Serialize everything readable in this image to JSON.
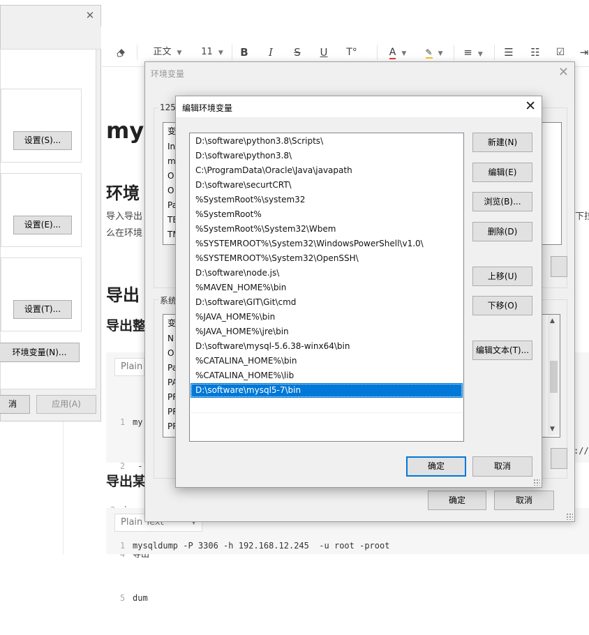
{
  "toolbar": {
    "eraser_icon": "eraser-icon",
    "style_value": "正文",
    "font_size": "11",
    "bold": "B",
    "italic": "I",
    "strike": "S",
    "underline": "U",
    "super": "T°",
    "font_color": "A",
    "highlight": "✎"
  },
  "document": {
    "heading1": "mys",
    "heading2": "环境",
    "para1_left": "导入导出",
    "para1_right": "下拉",
    "para2_left": "么在环境",
    "heading3": "导出",
    "heading4": "导出整",
    "heading5": "导出某",
    "code1_lang": "Plain",
    "code1_lines": [
      {
        "n": "1",
        "t": "my"
      },
      {
        "n": "2",
        "t": " -"
      },
      {
        "n": "3",
        "t": "ip-"
      },
      {
        "n": "4",
        "t": "导出"
      },
      {
        "n": "5",
        "t": "dum"
      }
    ],
    "code1_right": "://",
    "code2_lang": "Plain Text",
    "code2_line_no": "1",
    "code2_line": "mysqldump -P 3306 -h 192.168.12.245  -u root -proot"
  },
  "system_dialog": {
    "btn_settings_s": "设置(S)...",
    "btn_settings_e": "设置(E)...",
    "btn_settings_t": "设置(T)...",
    "btn_env": "环境变量(N)...",
    "btn_cancel": "消",
    "btn_apply": "应用(A)"
  },
  "env_dialog": {
    "title": "环境变量",
    "user_group": "125",
    "user_col": "变",
    "user_rows": [
      "In",
      "m",
      "O",
      "O",
      "Pa",
      "TE",
      "TM"
    ],
    "sys_group": "系统",
    "sys_col": "变",
    "sys_rows": [
      "N",
      "O",
      "Pa",
      "PA",
      "PR",
      "PR",
      "PR"
    ],
    "ok": "确定",
    "cancel": "取消"
  },
  "edit_dialog": {
    "title": "编辑环境变量",
    "paths": [
      "D:\\software\\python3.8\\Scripts\\",
      "D:\\software\\python3.8\\",
      "C:\\ProgramData\\Oracle\\Java\\javapath",
      "D:\\software\\securtCRT\\",
      "%SystemRoot%\\system32",
      "%SystemRoot%",
      "%SystemRoot%\\System32\\Wbem",
      "%SYSTEMROOT%\\System32\\WindowsPowerShell\\v1.0\\",
      "%SYSTEMROOT%\\System32\\OpenSSH\\",
      "D:\\software\\node.js\\",
      "%MAVEN_HOME%\\bin",
      "D:\\software\\GIT\\Git\\cmd",
      "%JAVA_HOME%\\bin",
      "%JAVA_HOME%\\jre\\bin",
      "D:\\software\\mysql-5.6.38-winx64\\bin",
      "%CATALINA_HOME%\\bin",
      "%CATALINA_HOME%\\lib",
      "D:\\software\\mysql5-7\\bin"
    ],
    "selected_index": 17,
    "btn_new": "新建(N)",
    "btn_edit": "编辑(E)",
    "btn_browse": "浏览(B)...",
    "btn_delete": "删除(D)",
    "btn_up": "上移(U)",
    "btn_down": "下移(O)",
    "btn_edit_text": "编辑文本(T)...",
    "ok": "确定",
    "cancel": "取消"
  }
}
